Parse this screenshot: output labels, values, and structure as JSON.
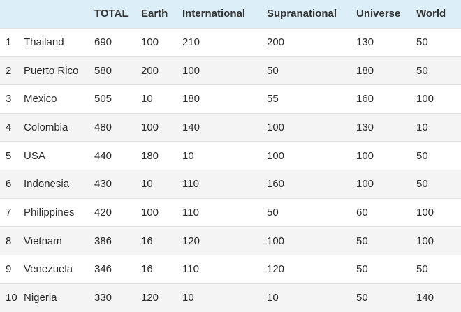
{
  "table": {
    "headers": [
      "",
      "",
      "TOTAL",
      "Earth",
      "International",
      "Supranational",
      "Universe",
      "World"
    ],
    "rows": [
      [
        "1",
        "Thailand",
        "690",
        "100",
        "210",
        "200",
        "130",
        "50"
      ],
      [
        "2",
        "Puerto Rico",
        "580",
        "200",
        "100",
        "50",
        "180",
        "50"
      ],
      [
        "3",
        "Mexico",
        "505",
        "10",
        "180",
        "55",
        "160",
        "100"
      ],
      [
        "4",
        "Colombia",
        "480",
        "100",
        "140",
        "100",
        "130",
        "10"
      ],
      [
        "5",
        "USA",
        "440",
        "180",
        "10",
        "100",
        "100",
        "50"
      ],
      [
        "6",
        "Indonesia",
        "430",
        "10",
        "110",
        "160",
        "100",
        "50"
      ],
      [
        "7",
        "Philippines",
        "420",
        "100",
        "110",
        "50",
        "60",
        "100"
      ],
      [
        "8",
        "Vietnam",
        "386",
        "16",
        "120",
        "100",
        "50",
        "100"
      ],
      [
        "9",
        "Venezuela",
        "346",
        "16",
        "110",
        "120",
        "50",
        "50"
      ],
      [
        "10",
        "Nigeria",
        "330",
        "120",
        "10",
        "10",
        "50",
        "140"
      ]
    ]
  },
  "colors": {
    "header_background": "#dceef8",
    "row_alt_background": "#f4f4f4",
    "row_border": "#e2e2e2"
  }
}
